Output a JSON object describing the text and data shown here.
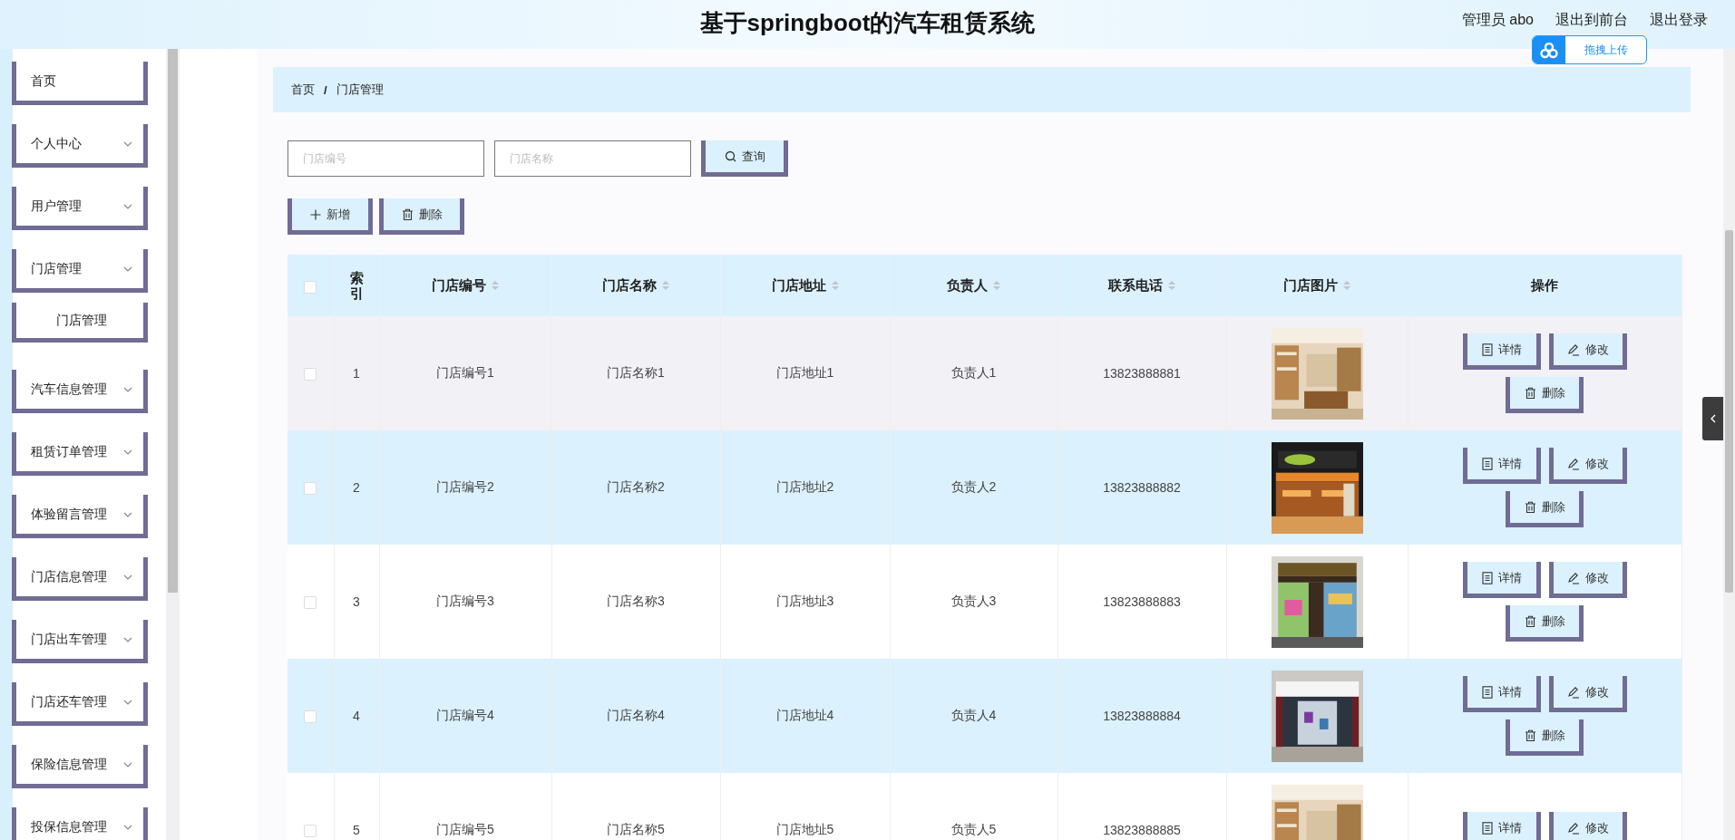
{
  "header": {
    "title": "基于springboot的汽车租赁系统",
    "user": "管理员 abo",
    "links": [
      "退出到前台",
      "退出登录"
    ]
  },
  "upload_widget": {
    "label": "拖拽上传"
  },
  "sidebar": {
    "items": [
      {
        "label": "首页",
        "kind": "link"
      },
      {
        "label": "个人中心",
        "kind": "submenu"
      },
      {
        "label": "用户管理",
        "kind": "submenu"
      },
      {
        "label": "门店管理",
        "kind": "submenu",
        "children": [
          {
            "label": "门店管理"
          }
        ]
      },
      {
        "label": "汽车信息管理",
        "kind": "submenu"
      },
      {
        "label": "租赁订单管理",
        "kind": "submenu"
      },
      {
        "label": "体验留言管理",
        "kind": "submenu"
      },
      {
        "label": "门店信息管理",
        "kind": "submenu"
      },
      {
        "label": "门店出车管理",
        "kind": "submenu"
      },
      {
        "label": "门店还车管理",
        "kind": "submenu"
      },
      {
        "label": "保险信息管理",
        "kind": "submenu"
      },
      {
        "label": "投保信息管理",
        "kind": "submenu"
      }
    ]
  },
  "breadcrumb": {
    "items": [
      "首页",
      "门店管理"
    ],
    "separator": "/"
  },
  "search": {
    "fields": [
      {
        "placeholder": "门店编号"
      },
      {
        "placeholder": "门店名称"
      }
    ],
    "button": "查询"
  },
  "actions": [
    {
      "label": "新增",
      "kind": "add"
    },
    {
      "label": "删除",
      "kind": "delete"
    }
  ],
  "table": {
    "header_checkbox": {
      "checked": false
    },
    "columns": [
      {
        "label": "索引",
        "sortable": false
      },
      {
        "label": "门店编号",
        "sortable": true
      },
      {
        "label": "门店名称",
        "sortable": true
      },
      {
        "label": "门店地址",
        "sortable": true
      },
      {
        "label": "负责人",
        "sortable": true
      },
      {
        "label": "联系电话",
        "sortable": true
      },
      {
        "label": "门店图片",
        "sortable": true
      },
      {
        "label": "操作",
        "sortable": false
      }
    ],
    "rows": [
      {
        "checked": false,
        "hovered": true,
        "cells": [
          "1",
          "门店编号1",
          "门店名称1",
          "门店地址1",
          "负责人1",
          "13823888881"
        ],
        "picture": {
          "kind": "picture"
        },
        "actions": [
          {
            "label": "详情",
            "kind": "detail"
          },
          {
            "label": "修改",
            "kind": "edit"
          },
          {
            "label": "删除",
            "kind": "delete"
          }
        ]
      },
      {
        "checked": false,
        "hovered": false,
        "cells": [
          "2",
          "门店编号2",
          "门店名称2",
          "门店地址2",
          "负责人2",
          "13823888882"
        ],
        "picture": {
          "kind": "picture"
        },
        "actions": [
          {
            "label": "详情",
            "kind": "detail"
          },
          {
            "label": "修改",
            "kind": "edit"
          },
          {
            "label": "删除",
            "kind": "delete"
          }
        ]
      },
      {
        "checked": false,
        "hovered": false,
        "cells": [
          "3",
          "门店编号3",
          "门店名称3",
          "门店地址3",
          "负责人3",
          "13823888883"
        ],
        "picture": {
          "kind": "picture"
        },
        "actions": [
          {
            "label": "详情",
            "kind": "detail"
          },
          {
            "label": "修改",
            "kind": "edit"
          },
          {
            "label": "删除",
            "kind": "delete"
          }
        ]
      },
      {
        "checked": false,
        "hovered": false,
        "cells": [
          "4",
          "门店编号4",
          "门店名称4",
          "门店地址4",
          "负责人4",
          "13823888884"
        ],
        "picture": {
          "kind": "picture"
        },
        "actions": [
          {
            "label": "详情",
            "kind": "detail"
          },
          {
            "label": "修改",
            "kind": "edit"
          },
          {
            "label": "删除",
            "kind": "delete"
          }
        ]
      },
      {
        "checked": false,
        "hovered": false,
        "cells": [
          "5",
          "门店编号5",
          "门店名称5",
          "门店地址5",
          "负责人5",
          "13823888885"
        ],
        "picture": {
          "kind": "picture"
        },
        "actions": [
          {
            "label": "详情",
            "kind": "detail"
          },
          {
            "label": "修改",
            "kind": "edit"
          }
        ]
      }
    ]
  }
}
